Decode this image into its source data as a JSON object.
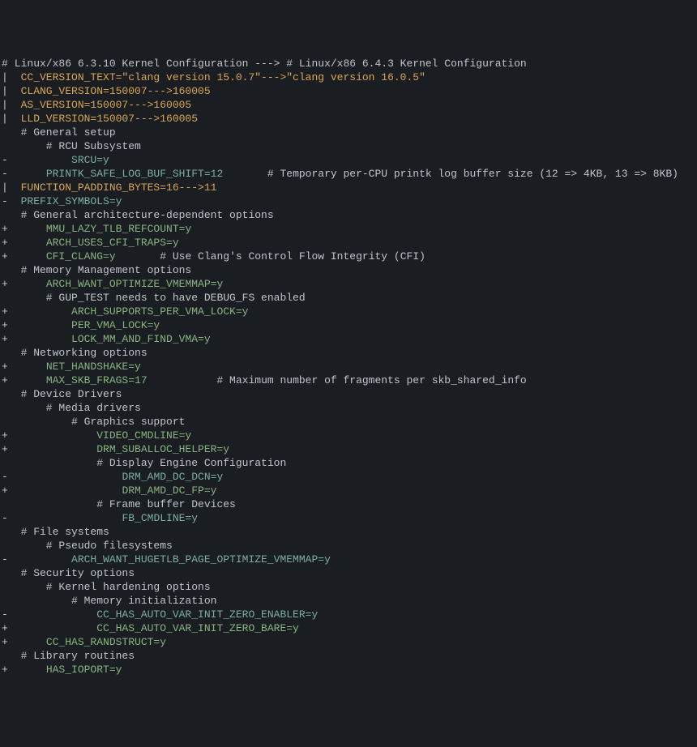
{
  "lines": [
    {
      "marker": "#",
      "segments": [
        {
          "cls": "white",
          "text": " Linux/x86 6.3.10 Kernel Configuration ---> # Linux/x86 6.4.3 Kernel Configuration"
        }
      ]
    },
    {
      "marker": "|",
      "segments": [
        {
          "cls": "yellow",
          "text": "  CC_VERSION_TEXT=\"clang version 15.0.7\"--->\"clang version 16.0.5\""
        }
      ]
    },
    {
      "marker": "|",
      "segments": [
        {
          "cls": "yellow",
          "text": "  CLANG_VERSION=150007--->160005"
        }
      ]
    },
    {
      "marker": "|",
      "segments": [
        {
          "cls": "yellow",
          "text": "  AS_VERSION=150007--->160005"
        }
      ]
    },
    {
      "marker": "|",
      "segments": [
        {
          "cls": "yellow",
          "text": "  LLD_VERSION=150007--->160005"
        }
      ]
    },
    {
      "marker": " ",
      "segments": [
        {
          "cls": "white",
          "text": "  # General setup"
        }
      ]
    },
    {
      "marker": " ",
      "segments": [
        {
          "cls": "white",
          "text": "      # RCU Subsystem"
        }
      ]
    },
    {
      "marker": "-",
      "segments": [
        {
          "cls": "white",
          "text": "          "
        },
        {
          "cls": "cyan",
          "text": "SRCU=y"
        }
      ]
    },
    {
      "marker": "-",
      "segments": [
        {
          "cls": "white",
          "text": "      "
        },
        {
          "cls": "cyan",
          "text": "PRINTK_SAFE_LOG_BUF_SHIFT=12"
        },
        {
          "cls": "white",
          "text": "       # Temporary per-CPU printk log buffer size (12 => 4KB, 13 => 8KB)"
        }
      ]
    },
    {
      "marker": "|",
      "segments": [
        {
          "cls": "white",
          "text": "  "
        },
        {
          "cls": "yellow",
          "text": "FUNCTION_PADDING_BYTES=16--->11"
        }
      ]
    },
    {
      "marker": "-",
      "segments": [
        {
          "cls": "white",
          "text": "  "
        },
        {
          "cls": "cyan",
          "text": "PREFIX_SYMBOLS=y"
        }
      ]
    },
    {
      "marker": " ",
      "segments": [
        {
          "cls": "white",
          "text": "  # General architecture-dependent options"
        }
      ]
    },
    {
      "marker": "+",
      "segments": [
        {
          "cls": "white",
          "text": "      "
        },
        {
          "cls": "green",
          "text": "MMU_LAZY_TLB_REFCOUNT=y"
        }
      ]
    },
    {
      "marker": "+",
      "segments": [
        {
          "cls": "white",
          "text": "      "
        },
        {
          "cls": "green",
          "text": "ARCH_USES_CFI_TRAPS=y"
        }
      ]
    },
    {
      "marker": "+",
      "segments": [
        {
          "cls": "white",
          "text": "      "
        },
        {
          "cls": "green",
          "text": "CFI_CLANG=y"
        },
        {
          "cls": "white",
          "text": "       # Use Clang's Control Flow Integrity (CFI)"
        }
      ]
    },
    {
      "marker": " ",
      "segments": [
        {
          "cls": "white",
          "text": "  # Memory Management options"
        }
      ]
    },
    {
      "marker": "+",
      "segments": [
        {
          "cls": "white",
          "text": "      "
        },
        {
          "cls": "green",
          "text": "ARCH_WANT_OPTIMIZE_VMEMMAP=y"
        }
      ]
    },
    {
      "marker": " ",
      "segments": [
        {
          "cls": "white",
          "text": "      # GUP_TEST needs to have DEBUG_FS enabled"
        }
      ]
    },
    {
      "marker": "+",
      "segments": [
        {
          "cls": "white",
          "text": "          "
        },
        {
          "cls": "green",
          "text": "ARCH_SUPPORTS_PER_VMA_LOCK=y"
        }
      ]
    },
    {
      "marker": "+",
      "segments": [
        {
          "cls": "white",
          "text": "          "
        },
        {
          "cls": "green",
          "text": "PER_VMA_LOCK=y"
        }
      ]
    },
    {
      "marker": "+",
      "segments": [
        {
          "cls": "white",
          "text": "          "
        },
        {
          "cls": "green",
          "text": "LOCK_MM_AND_FIND_VMA=y"
        }
      ]
    },
    {
      "marker": " ",
      "segments": [
        {
          "cls": "white",
          "text": "  # Networking options"
        }
      ]
    },
    {
      "marker": "+",
      "segments": [
        {
          "cls": "white",
          "text": "      "
        },
        {
          "cls": "green",
          "text": "NET_HANDSHAKE=y"
        }
      ]
    },
    {
      "marker": "+",
      "segments": [
        {
          "cls": "white",
          "text": "      "
        },
        {
          "cls": "green",
          "text": "MAX_SKB_FRAGS=17"
        },
        {
          "cls": "white",
          "text": "           # Maximum number of fragments per skb_shared_info"
        }
      ]
    },
    {
      "marker": " ",
      "segments": [
        {
          "cls": "white",
          "text": "  # Device Drivers"
        }
      ]
    },
    {
      "marker": " ",
      "segments": [
        {
          "cls": "white",
          "text": "      # Media drivers"
        }
      ]
    },
    {
      "marker": " ",
      "segments": [
        {
          "cls": "white",
          "text": "          # Graphics support"
        }
      ]
    },
    {
      "marker": "+",
      "segments": [
        {
          "cls": "white",
          "text": "              "
        },
        {
          "cls": "green",
          "text": "VIDEO_CMDLINE=y"
        }
      ]
    },
    {
      "marker": "+",
      "segments": [
        {
          "cls": "white",
          "text": "              "
        },
        {
          "cls": "green",
          "text": "DRM_SUBALLOC_HELPER=y"
        }
      ]
    },
    {
      "marker": " ",
      "segments": [
        {
          "cls": "white",
          "text": "              # Display Engine Configuration"
        }
      ]
    },
    {
      "marker": "-",
      "segments": [
        {
          "cls": "white",
          "text": "                  "
        },
        {
          "cls": "cyan",
          "text": "DRM_AMD_DC_DCN=y"
        }
      ]
    },
    {
      "marker": "+",
      "segments": [
        {
          "cls": "white",
          "text": "                  "
        },
        {
          "cls": "green",
          "text": "DRM_AMD_DC_FP=y"
        }
      ]
    },
    {
      "marker": " ",
      "segments": [
        {
          "cls": "white",
          "text": "              # Frame buffer Devices"
        }
      ]
    },
    {
      "marker": "-",
      "segments": [
        {
          "cls": "white",
          "text": "                  "
        },
        {
          "cls": "cyan",
          "text": "FB_CMDLINE=y"
        }
      ]
    },
    {
      "marker": " ",
      "segments": [
        {
          "cls": "white",
          "text": "  # File systems"
        }
      ]
    },
    {
      "marker": " ",
      "segments": [
        {
          "cls": "white",
          "text": "      # Pseudo filesystems"
        }
      ]
    },
    {
      "marker": "-",
      "segments": [
        {
          "cls": "white",
          "text": "          "
        },
        {
          "cls": "cyan",
          "text": "ARCH_WANT_HUGETLB_PAGE_OPTIMIZE_VMEMMAP=y"
        }
      ]
    },
    {
      "marker": " ",
      "segments": [
        {
          "cls": "white",
          "text": "  # Security options"
        }
      ]
    },
    {
      "marker": " ",
      "segments": [
        {
          "cls": "white",
          "text": "      # Kernel hardening options"
        }
      ]
    },
    {
      "marker": " ",
      "segments": [
        {
          "cls": "white",
          "text": "          # Memory initialization"
        }
      ]
    },
    {
      "marker": "-",
      "segments": [
        {
          "cls": "white",
          "text": "              "
        },
        {
          "cls": "cyan",
          "text": "CC_HAS_AUTO_VAR_INIT_ZERO_ENABLER=y"
        }
      ]
    },
    {
      "marker": "+",
      "segments": [
        {
          "cls": "white",
          "text": "              "
        },
        {
          "cls": "green",
          "text": "CC_HAS_AUTO_VAR_INIT_ZERO_BARE=y"
        }
      ]
    },
    {
      "marker": "+",
      "segments": [
        {
          "cls": "white",
          "text": "      "
        },
        {
          "cls": "green",
          "text": "CC_HAS_RANDSTRUCT=y"
        }
      ]
    },
    {
      "marker": " ",
      "segments": [
        {
          "cls": "white",
          "text": "  # Library routines"
        }
      ]
    },
    {
      "marker": "+",
      "segments": [
        {
          "cls": "white",
          "text": "      "
        },
        {
          "cls": "green",
          "text": "HAS_IOPORT=y"
        }
      ]
    }
  ]
}
